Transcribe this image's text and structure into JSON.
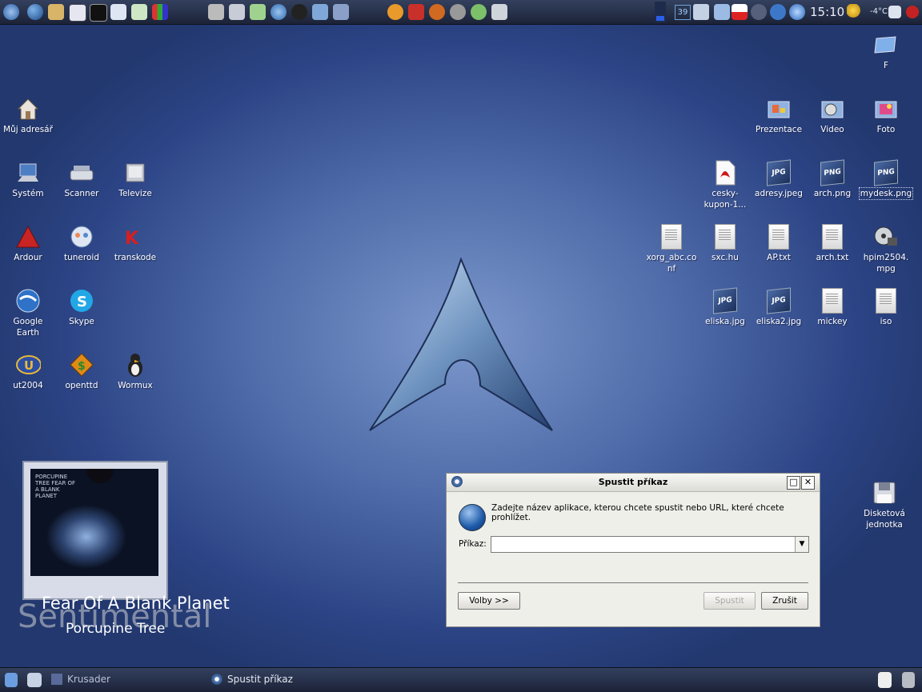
{
  "desktop": {
    "left_icons": [
      {
        "label": "Můj adresář",
        "icon": "home-folder-icon"
      },
      {
        "label": "Systém",
        "icon": "computer-icon"
      },
      {
        "label": "Scanner",
        "icon": "scanner-icon"
      },
      {
        "label": "Televize",
        "icon": "tv-icon"
      },
      {
        "label": "Ardour",
        "icon": "ardour-icon"
      },
      {
        "label": "tuneroid",
        "icon": "tuneroid-icon"
      },
      {
        "label": "transkode",
        "icon": "transkode-icon"
      },
      {
        "label": "Google Earth",
        "icon": "google-earth-icon"
      },
      {
        "label": "Skype",
        "icon": "skype-icon"
      },
      {
        "label": "ut2004",
        "icon": "ut2004-icon"
      },
      {
        "label": "openttd",
        "icon": "openttd-icon"
      },
      {
        "label": "Wormux",
        "icon": "wormux-icon"
      }
    ],
    "right_icons": [
      {
        "label": "F",
        "icon": "drive-icon"
      },
      {
        "label": "Prezentace",
        "icon": "presentation-folder-icon"
      },
      {
        "label": "Video",
        "icon": "video-folder-icon"
      },
      {
        "label": "Foto",
        "icon": "photo-folder-icon"
      },
      {
        "label": "cesky-kupon-1...",
        "icon": "pdf-file-icon"
      },
      {
        "label": "adresy.jpeg",
        "icon": "jpg-file-icon",
        "badge": "JPG"
      },
      {
        "label": "arch.png",
        "icon": "png-file-icon",
        "badge": "PNG"
      },
      {
        "label": "mydesk.png",
        "icon": "png-file-icon",
        "badge": "PNG"
      },
      {
        "label": "xorg_abc.conf",
        "icon": "text-file-icon"
      },
      {
        "label": "sxc.hu",
        "icon": "text-file-icon"
      },
      {
        "label": "AP.txt",
        "icon": "text-file-icon"
      },
      {
        "label": "arch.txt",
        "icon": "text-file-icon"
      },
      {
        "label": "hpim2504.mpg",
        "icon": "video-file-icon"
      },
      {
        "label": "eliska.jpg",
        "icon": "jpg-file-icon",
        "badge": "JPG"
      },
      {
        "label": "eliska2.jpg",
        "icon": "jpg-file-icon",
        "badge": "JPG"
      },
      {
        "label": "mickey",
        "icon": "text-file-icon"
      },
      {
        "label": "iso",
        "icon": "text-file-icon"
      },
      {
        "label": "Disketová jednotka",
        "icon": "floppy-icon"
      }
    ]
  },
  "topbar": {
    "clock": "15:10",
    "temperature": "-4°C",
    "desktop_number": "39"
  },
  "now_playing": {
    "title": "Fear Of A Blank Planet",
    "artist": "Porcupine Tree",
    "ghost_text": "Sentimental",
    "album_caption": "PORCUPINE TREE FEAR OF A BLANK PLANET"
  },
  "dialog": {
    "title": "Spustit příkaz",
    "message": "Zadejte název aplikace, kterou chcete spustit nebo URL, které chcete prohlížet.",
    "command_label": "Příkaz:",
    "command_value": "",
    "options_button": "Volby >>",
    "run_button": "Spustit",
    "cancel_button": "Zrušit"
  },
  "taskbar": {
    "tasks": [
      {
        "label": "Krusader"
      },
      {
        "label": "Spustit příkaz"
      }
    ]
  }
}
